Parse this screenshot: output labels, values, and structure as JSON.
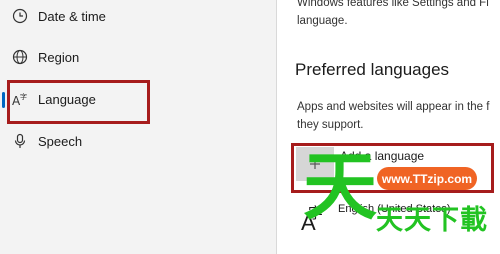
{
  "sidebar": {
    "items": [
      {
        "label": "Date & time",
        "icon": "clock-globe-icon"
      },
      {
        "label": "Region",
        "icon": "globe-icon"
      },
      {
        "label": "Language",
        "icon": "language-icon",
        "selected": true
      },
      {
        "label": "Speech",
        "icon": "microphone-icon"
      }
    ]
  },
  "main": {
    "desc_top": "Windows features like Settings and Fi",
    "desc_top_2": "language.",
    "section_title": "Preferred languages",
    "section_desc_1": "Apps and websites will appear in the f",
    "section_desc_2": "they support.",
    "add_language_label": "Add a language",
    "language_item_glyph": "字",
    "language_item_label": "English (United States)",
    "big_a": "A"
  },
  "watermark": {
    "char": "天",
    "url": "www.TTzip.com",
    "text": "天天下載"
  },
  "colors": {
    "highlight_border": "#a61c1c",
    "accent": "#0067c0",
    "watermark_green": "#22c322",
    "watermark_orange": "#f06424"
  }
}
